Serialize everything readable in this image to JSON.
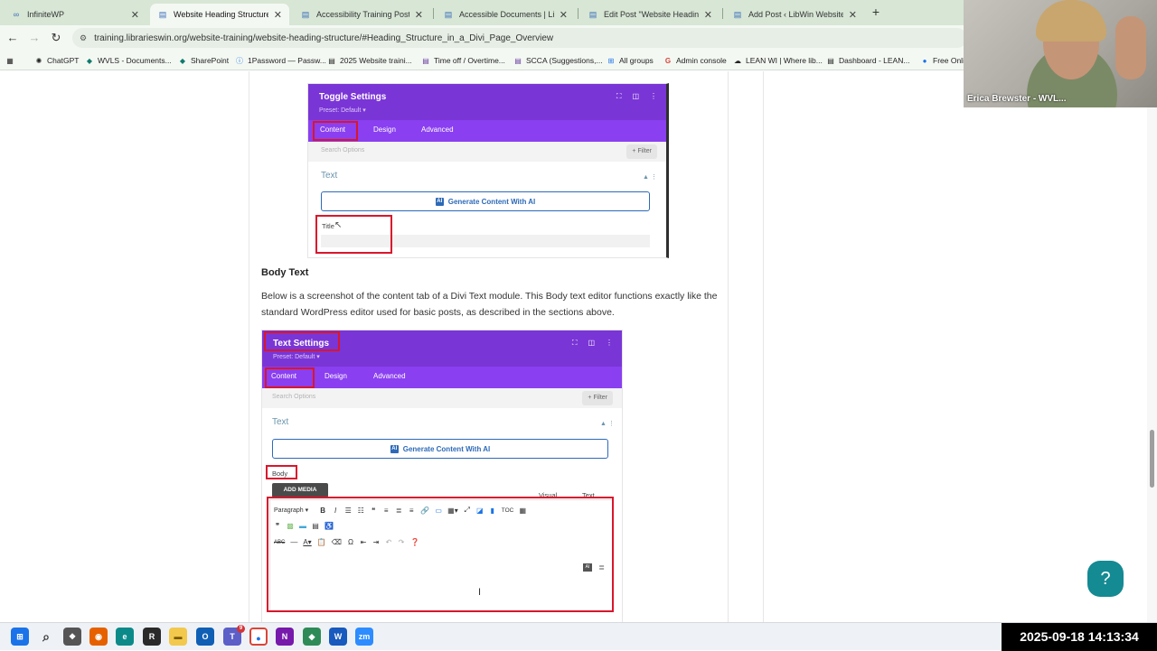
{
  "browser": {
    "tabs": [
      {
        "title": "InfiniteWP",
        "icon": "infinitewp-icon",
        "active": false
      },
      {
        "title": "Website Heading Structure | Lib",
        "icon": "page-icon",
        "active": true
      },
      {
        "title": "Accessibility Training Posts | Lit",
        "icon": "page-icon",
        "active": false
      },
      {
        "title": "Accessible Documents | LibWin",
        "icon": "page-icon",
        "active": false
      },
      {
        "title": "Edit Post \"Website Heading Str",
        "icon": "page-icon",
        "active": false
      },
      {
        "title": "Add Post ‹ LibWin Website Trai",
        "icon": "page-icon",
        "active": false
      }
    ],
    "close_glyph": "✕",
    "new_tab_glyph": "+",
    "url": "training.librarieswin.org/website-training/website-heading-structure/#Heading_Structure_in_a_Divi_Page_Overview",
    "bookmarks": [
      "ChatGPT",
      "WVLS - Documents...",
      "SharePoint",
      "1Password — Passw...",
      "2025 Website traini...",
      "Time off / Overtime...",
      "SCCA (Suggestions,...",
      "All groups",
      "Admin console",
      "LEAN WI | Where lib...",
      "Dashboard - LEAN...",
      "Free Onlin"
    ]
  },
  "toggle_panel": {
    "title": "Toggle Settings",
    "preset": "Preset: Default ▾",
    "tabs": [
      "Content",
      "Design",
      "Advanced"
    ],
    "search_placeholder": "Search Options",
    "filter": "+ Filter",
    "section": "Text",
    "generate_label": "Generate Content With AI",
    "field_label": "Title"
  },
  "article": {
    "heading": "Body Text",
    "paragraph": "Below is a screenshot of the content tab of a Divi Text module. This Body text editor functions exactly like the standard WordPress editor used for basic posts, as described in the sections above."
  },
  "text_panel": {
    "title": "Text Settings",
    "preset": "Preset: Default ▾",
    "tabs": [
      "Content",
      "Design",
      "Advanced"
    ],
    "search_placeholder": "Search Options",
    "filter": "+ Filter",
    "section": "Text",
    "generate_label": "Generate Content With AI",
    "field_label": "Body",
    "add_media": "ADD MEDIA",
    "visual_tab": "Visual",
    "text_tab": "Text",
    "format_select": "Paragraph",
    "toc_label": "TOC"
  },
  "webcam": {
    "name": "Erica Brewster - WVL..."
  },
  "help": {
    "label": "?"
  },
  "taskbar": {
    "datetime": "2025-09-18  14:13:34",
    "outlook_badge": "9"
  },
  "colors": {
    "divi_purple": "#7a35d6",
    "highlight_red": "#d9162c",
    "help_teal": "#148a93",
    "ai_blue": "#2d6ab8"
  }
}
